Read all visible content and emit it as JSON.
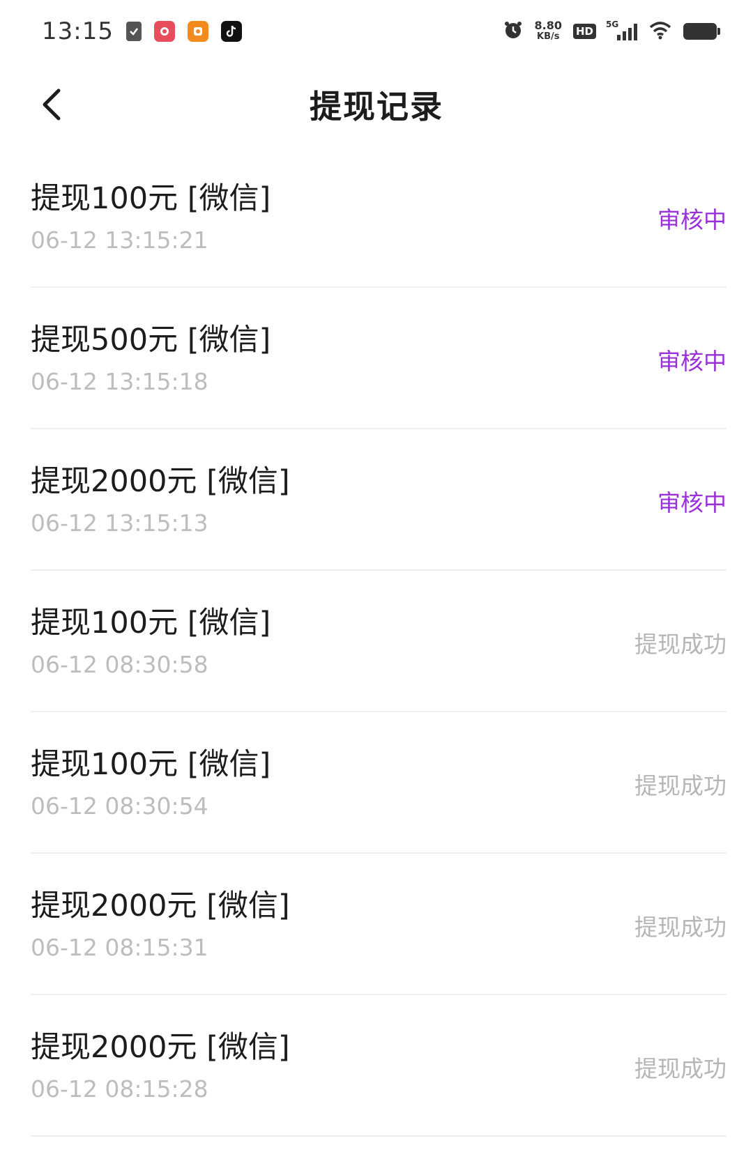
{
  "status_bar": {
    "time": "13:15",
    "net_speed_value": "8.80",
    "net_speed_unit": "KB/s",
    "hd": "HD",
    "network": "5G"
  },
  "nav": {
    "title": "提现记录"
  },
  "colors": {
    "pending": "#9b32d9",
    "success": "#b6b6b6",
    "time": "#bdbdbd"
  },
  "records": [
    {
      "title": "提现100元 [微信]",
      "time": "06-12 13:15:21",
      "status": "审核中"
    },
    {
      "title": "提现500元 [微信]",
      "time": "06-12 13:15:18",
      "status": "审核中"
    },
    {
      "title": "提现2000元 [微信]",
      "time": "06-12 13:15:13",
      "status": "审核中"
    },
    {
      "title": "提现100元 [微信]",
      "time": "06-12 08:30:58",
      "status": "提现成功"
    },
    {
      "title": "提现100元 [微信]",
      "time": "06-12 08:30:54",
      "status": "提现成功"
    },
    {
      "title": "提现2000元 [微信]",
      "time": "06-12 08:15:31",
      "status": "提现成功"
    },
    {
      "title": "提现2000元 [微信]",
      "time": "06-12 08:15:28",
      "status": "提现成功"
    }
  ]
}
